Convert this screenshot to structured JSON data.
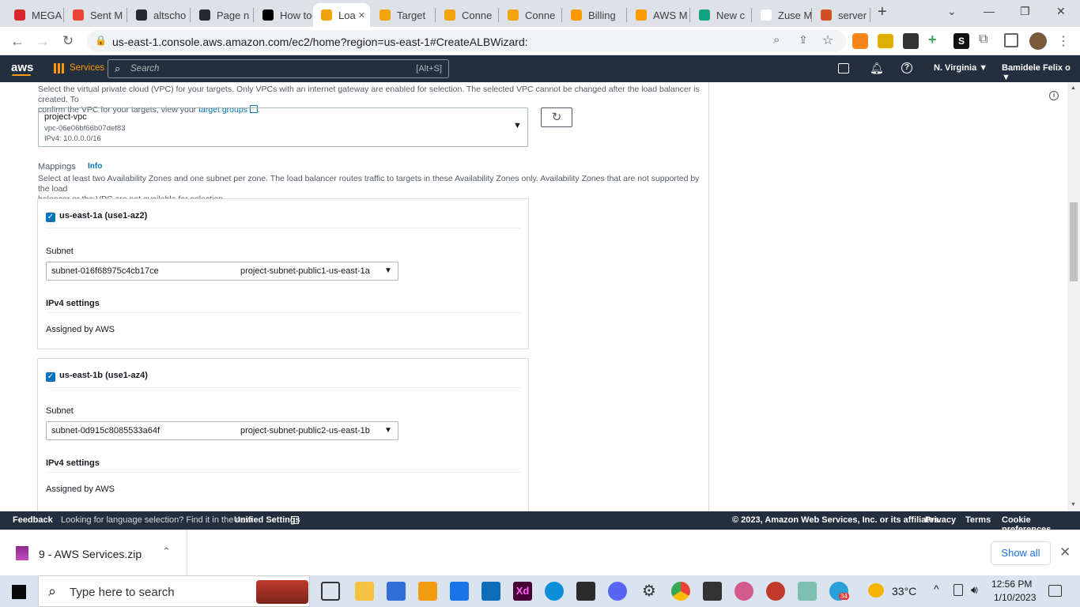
{
  "browser": {
    "tabs": [
      {
        "label": "MEGA",
        "color": "#d9272e"
      },
      {
        "label": "Sent M",
        "color": "#ea4335"
      },
      {
        "label": "altscho",
        "color": "#24292f"
      },
      {
        "label": "Page n",
        "color": "#24292f"
      },
      {
        "label": "How to",
        "color": "#000000"
      },
      {
        "label": "Loa",
        "color": "#f0a30a",
        "active": true
      },
      {
        "label": "Target",
        "color": "#f0a30a"
      },
      {
        "label": "Conne",
        "color": "#f0a30a"
      },
      {
        "label": "Conne",
        "color": "#f0a30a"
      },
      {
        "label": "Billing",
        "color": "#ff9900"
      },
      {
        "label": "AWS M",
        "color": "#ff9900"
      },
      {
        "label": "New c",
        "color": "#10a37f"
      },
      {
        "label": "Zuse M",
        "color": "#ffffff"
      },
      {
        "label": "server",
        "color": "#d04f24"
      }
    ],
    "url": "us-east-1.console.aws.amazon.com/ec2/home?region=us-east-1#CreateALBWizard:"
  },
  "aws_nav": {
    "logo": "aws",
    "services": "Services",
    "search_placeholder": "Search",
    "search_shortcut": "[Alt+S]",
    "region": "N. Virginia ▼",
    "user": "Bamidele Felix o ▼"
  },
  "vpc": {
    "description_1": "Select the virtual private cloud (VPC) for your targets. Only VPCs with an internet gateway are enabled for selection. The selected VPC cannot be changed after the load balancer is created. To",
    "description_2_prefix": "confirm the VPC for your targets, view your ",
    "description_2_link": "target groups",
    "name": "project-vpc",
    "id": "vpc-06e06bf66b07def83",
    "cidr": "IPv4: 10.0.0.0/16"
  },
  "mappings": {
    "title": "Mappings",
    "info": "Info",
    "description_1": "Select at least two Availability Zones and one subnet per zone. The load balancer routes traffic to targets in these Availability Zones only. Availability Zones that are not supported by the load",
    "description_2": "balancer or the VPC are not available for selection.",
    "zones": [
      {
        "name": "us-east-1a (use1-az2)",
        "subnet_label": "Subnet",
        "subnet_id": "subnet-016f68975c4cb17ce",
        "subnet_name": "project-subnet-public1-us-east-1a",
        "ipv4_label": "IPv4 settings",
        "ipv4_value": "Assigned by AWS"
      },
      {
        "name": "us-east-1b (use1-az4)",
        "subnet_label": "Subnet",
        "subnet_id": "subnet-0d915c8085533a64f",
        "subnet_name": "project-subnet-public2-us-east-1b",
        "ipv4_label": "IPv4 settings",
        "ipv4_value": "Assigned by AWS"
      }
    ]
  },
  "footer": {
    "feedback": "Feedback",
    "language_text": "Looking for language selection? Find it in the new",
    "unified_settings": "Unified Settings",
    "copyright": "© 2023, Amazon Web Services, Inc. or its affiliates.",
    "privacy": "Privacy",
    "terms": "Terms",
    "cookies": "Cookie preferences"
  },
  "downloads": {
    "file": "9 - AWS Services.zip",
    "show_all": "Show all"
  },
  "taskbar": {
    "search_placeholder": "Type here to search",
    "weather": "33°C",
    "time": "12:56 PM",
    "date": "1/10/2023",
    "notification_count": "34"
  }
}
